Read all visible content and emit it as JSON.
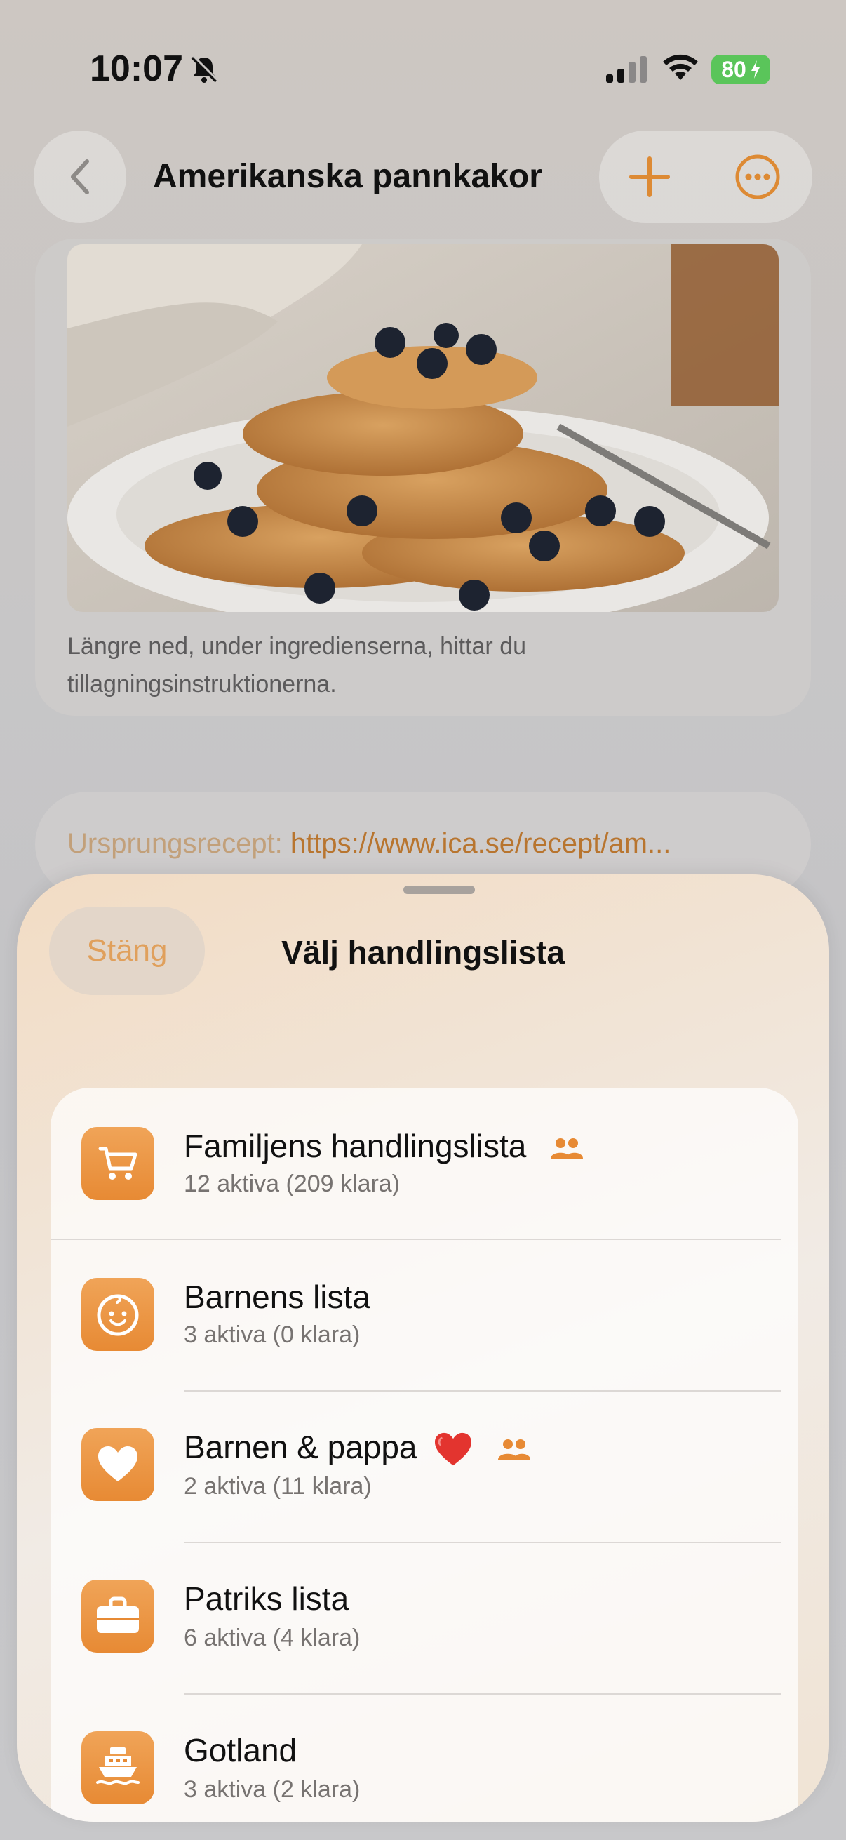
{
  "status_bar": {
    "time": "10:07",
    "battery": "80"
  },
  "nav": {
    "title": "Amerikanska pannkakor"
  },
  "recipe": {
    "caption": "Längre ned, under ingredienserna, hittar du tillagningsinstruktionerna.",
    "source_label": "Ursprungsrecept:",
    "source_link": "https://www.ica.se/recept/am..."
  },
  "sheet": {
    "close_label": "Stäng",
    "title": "Välj handlingslista",
    "lists": [
      {
        "name": "Familjens handlingslista",
        "sub": "12 aktiva (209 klara)",
        "icon": "cart-icon",
        "shared": true
      },
      {
        "name": "Barnens lista",
        "sub": "3 aktiva (0 klara)",
        "icon": "baby-face-icon",
        "shared": false
      },
      {
        "name": "Barnen & pappa",
        "sub": "2 aktiva (11 klara)",
        "icon": "heart-icon",
        "shared": true
      },
      {
        "name": "Patriks lista",
        "sub": "6 aktiva (4 klara)",
        "icon": "briefcase-icon",
        "shared": false
      },
      {
        "name": "Gotland",
        "sub": "3 aktiva (2 klara)",
        "icon": "ferry-icon",
        "shared": false
      }
    ]
  },
  "colors": {
    "accent": "#e78a34",
    "link": "#b8752f",
    "battery": "#5ac55a"
  }
}
